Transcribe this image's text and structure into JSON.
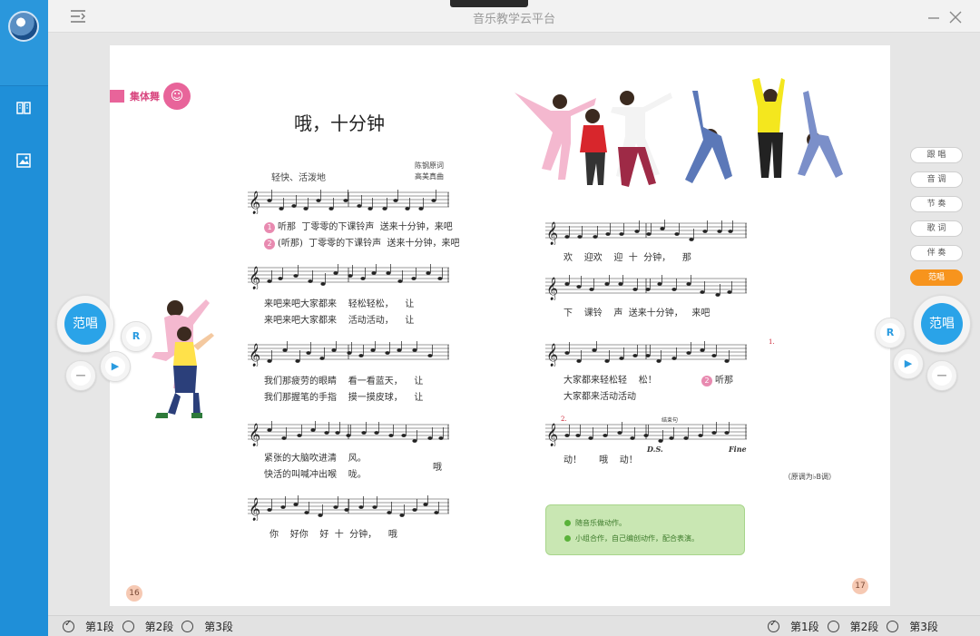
{
  "app": {
    "title": "音乐教学云平台"
  },
  "left_page": {
    "section_label": "集体舞",
    "song_title": "哦，十分钟",
    "tempo": "轻快、活泼地",
    "credits": [
      "陈钢原词",
      "高美真曲"
    ],
    "lines": [
      {
        "l1": "听那  丁零零的下课铃声  送来十分钟，来吧",
        "l2": "(听那)  丁零零的下课铃声  送来十分钟，来吧"
      },
      {
        "l1": "来吧来吧大家都来    轻松轻松，    让",
        "l2": "来吧来吧大家都来    活动活动，    让"
      },
      {
        "l1": "我们那疲劳的眼睛    看一看蓝天，    让",
        "l2": "我们那握笔的手指    摸一摸皮球，    让"
      },
      {
        "l1": "紧张的大脑吹进清    风。",
        "l2": "快活的叫喊冲出喉    咙。"
      },
      {
        "l1": "你    好你    好  十  分钟，    哦",
        "l2": ""
      }
    ],
    "verse_nums": [
      "1",
      "2"
    ],
    "oh": "哦",
    "page_number": "16"
  },
  "right_page": {
    "lines": [
      "欢    迎欢    迎  十  分钟，    那",
      "下    课铃    声  送来十分钟，   来吧",
      "大家都来轻松轻    松！",
      "大家都来活动活动",
      "动！      哦    动！"
    ],
    "verse_two": "2",
    "listen": "听那",
    "ending_one": "1.",
    "ending_two": "2.",
    "ending_label": "结束句",
    "ds": "D.S.",
    "fine": "Fine",
    "key_note": "（原调为♭B调）",
    "tips": [
      "随音乐做动作。",
      "小组合作，自己编创动作，配合表演。"
    ],
    "page_number": "17"
  },
  "mode_buttons": [
    "跟 唱",
    "音 调",
    "节 奏",
    "歌 词",
    "伴 奏",
    "范唱"
  ],
  "player": {
    "left_main": "范唱",
    "right_main": "范唱",
    "repeat": "R",
    "play": "▶",
    "stop": "—"
  },
  "segments_left": [
    {
      "label": "第1段",
      "checked": true
    },
    {
      "label": "第2段",
      "checked": false
    },
    {
      "label": "第3段",
      "checked": false
    }
  ],
  "segments_right": [
    {
      "label": "第1段",
      "checked": true
    },
    {
      "label": "第2段",
      "checked": false
    },
    {
      "label": "第3段",
      "checked": false
    }
  ],
  "colors": {
    "sidebar": "#1f8fd8",
    "accent_blue": "#2aa3e8",
    "accent_orange": "#f7941d",
    "section_pink": "#e8649a"
  },
  "icons": {
    "book": "book-icon",
    "image": "image-icon",
    "menu": "menu-icon",
    "minimize": "minimize-icon",
    "close": "close-icon"
  }
}
